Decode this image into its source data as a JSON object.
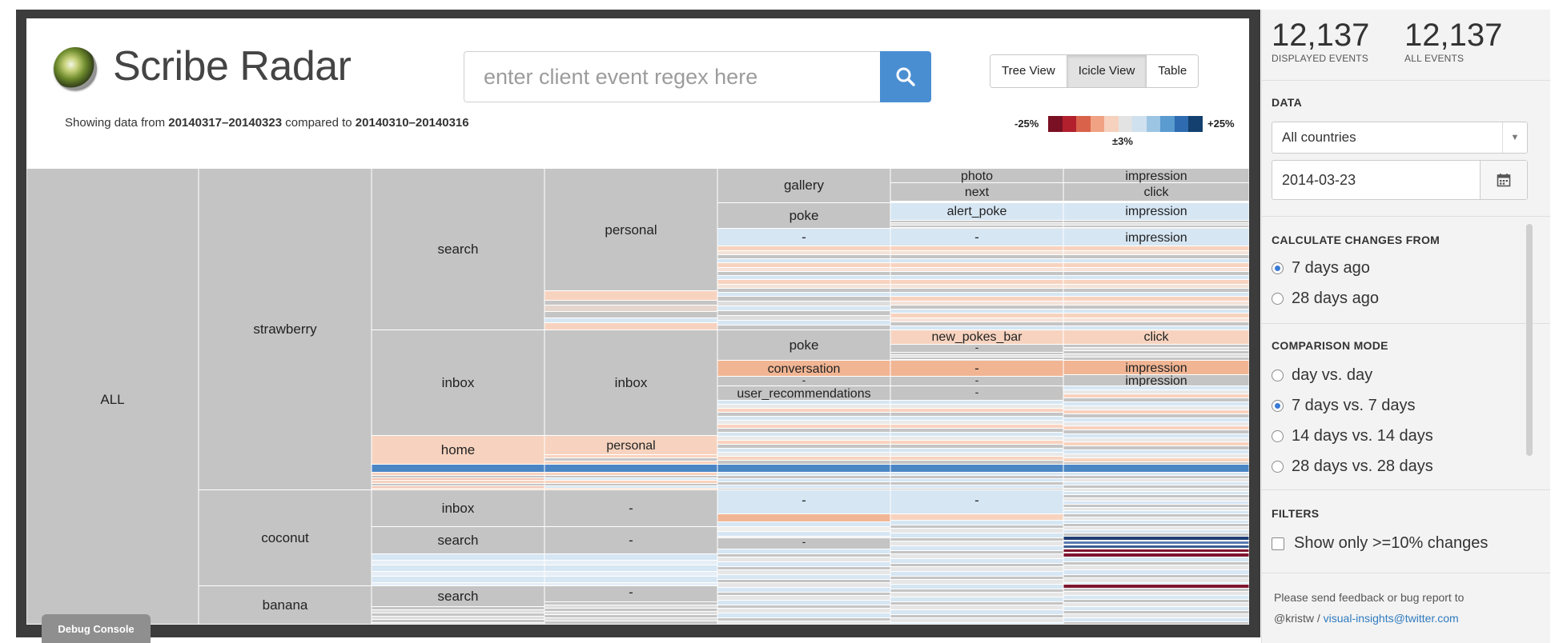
{
  "app": {
    "title": "Scribe Radar",
    "subtitle_prefix": "Showing data from ",
    "range_current": "20140317–20140323",
    "subtitle_mid": " compared to ",
    "range_previous": "20140310–20140316"
  },
  "search": {
    "placeholder": "enter client event regex here",
    "value": ""
  },
  "view_tabs": [
    {
      "label": "Tree View",
      "active": false
    },
    {
      "label": "Icicle View",
      "active": true
    },
    {
      "label": "Table",
      "active": false
    }
  ],
  "legend": {
    "min_label": "-25%",
    "max_label": "+25%",
    "mid_label": "±3%",
    "swatches": [
      "#7a1023",
      "#b2202e",
      "#d9624a",
      "#f0a282",
      "#f6d1bd",
      "#e3e3e3",
      "#cfe1ef",
      "#9cc5e3",
      "#5a9bd0",
      "#2e6bb0",
      "#14406f"
    ]
  },
  "colors": {
    "neutral": "#c4c4c4",
    "light_blue": "#d6e6f3",
    "light_orange": "#f7d3bf",
    "orange": "#f1b594",
    "blue": "#4b86c4",
    "dark_red": "#7e1530",
    "navy": "#1f3f73"
  },
  "icicle": {
    "columns": [
      "root",
      "client",
      "page",
      "section",
      "component",
      "element",
      "action"
    ],
    "labels": {
      "all": "ALL",
      "strawberry": "strawberry",
      "coconut": "coconut",
      "banana": "banana",
      "search": "search",
      "inbox": "inbox",
      "home": "home",
      "personal": "personal",
      "dash": "-",
      "gallery": "gallery",
      "poke": "poke",
      "conversation": "conversation",
      "user_recommendations": "user_recommendations",
      "photo": "photo",
      "next": "next",
      "alert_poke": "alert_poke",
      "new_pokes_bar": "new_pokes_bar",
      "impression": "impression",
      "click": "click"
    }
  },
  "debug_console": "Debug Console",
  "sidebar": {
    "displayed_events": "12,137",
    "displayed_label": "DISPLAYED EVENTS",
    "all_events": "12,137",
    "all_label": "ALL EVENTS",
    "data_title": "DATA",
    "country": "All countries",
    "date": "2014-03-23",
    "changes_title": "CALCULATE CHANGES FROM",
    "changes_options": [
      {
        "label": "7 days ago",
        "selected": true
      },
      {
        "label": "28 days ago",
        "selected": false
      }
    ],
    "mode_title": "COMPARISON MODE",
    "mode_options": [
      {
        "label": "day vs. day",
        "selected": false
      },
      {
        "label": "7 days vs. 7 days",
        "selected": true
      },
      {
        "label": "14 days vs. 14 days",
        "selected": false
      },
      {
        "label": "28 days vs. 28 days",
        "selected": false
      }
    ],
    "filters_title": "FILTERS",
    "filter_label": "Show only >=10% changes",
    "feedback_text": "Please send feedback or bug report to",
    "feedback_handle": "@kristw",
    "feedback_sep": " / ",
    "feedback_email": "visual-insights@twitter.com"
  }
}
